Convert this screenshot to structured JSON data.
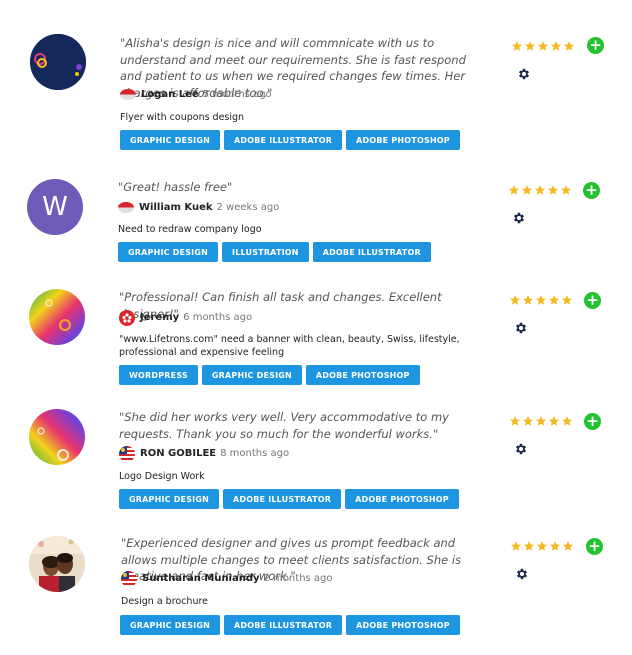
{
  "reviews": [
    {
      "avatar": "ring-logo-avatar",
      "quote": "\"Alisha's design is nice and will commnicate with us to understand and meet our requirements. She is fast respond and patient to us when we required changes few times. Her charges is affordable too.\"",
      "flag": "indonesia-flag",
      "name": "Logan Lee",
      "time": "5 months ago",
      "project": "Flyer with coupons design",
      "tags": [
        "GRAPHIC DESIGN",
        "ADOBE ILLUSTRATOR",
        "ADOBE PHOTOSHOP"
      ],
      "rating": 5
    },
    {
      "avatar": "letter-avatar",
      "avatar_letter": "W",
      "quote": "\"Great! hassle free\"",
      "flag": "indonesia-flag",
      "name": "William Kuek",
      "time": "2 weeks ago",
      "project": "Need to redraw company logo",
      "tags": [
        "GRAPHIC DESIGN",
        "ILLUSTRATION",
        "ADOBE ILLUSTRATOR"
      ],
      "rating": 5
    },
    {
      "avatar": "rainbow-avatar",
      "quote": "\"Professional! Can finish all task and changes. Excellent designer!\"",
      "flag": "hong-kong-flag",
      "name": "Jeremy",
      "time": "6 months ago",
      "project": "\"www.Lifetrons.com\" need a banner with clean, beauty, Swiss, lifestyle, professional and expensive feeling",
      "tags": [
        "WORDPRESS",
        "GRAPHIC DESIGN",
        "ADOBE PHOTOSHOP"
      ],
      "rating": 5
    },
    {
      "avatar": "rainbow-avatar",
      "quote": "\"She did her works very well. Very accommodative to my requests. Thank you so much for the wonderful works.\"",
      "flag": "malaysia-flag",
      "name": "RON GOBILEE",
      "time": "8 months ago",
      "project": "Logo Design Work",
      "tags": [
        "GRAPHIC DESIGN",
        "ADOBE ILLUSTRATOR",
        "ADOBE PHOTOSHOP"
      ],
      "rating": 5
    },
    {
      "avatar": "photo-avatar",
      "quote": "\"Experienced designer and gives us prompt feedback and allows multiple changes to meet clients satisfaction. She is creative and fast in her work.\"",
      "flag": "malaysia-flag",
      "name": "Suntharan Muniandy",
      "time": "2 months ago",
      "project": "Design a brochure",
      "tags": [
        "GRAPHIC DESIGN",
        "ADOBE ILLUSTRATOR",
        "ADOBE PHOTOSHOP"
      ],
      "rating": 5
    }
  ],
  "colors": {
    "tag": "#1d95e0",
    "star": "#f5b820",
    "plus": "#22c32e",
    "gear": "#1e2a4a"
  },
  "plus_symbol": "+"
}
